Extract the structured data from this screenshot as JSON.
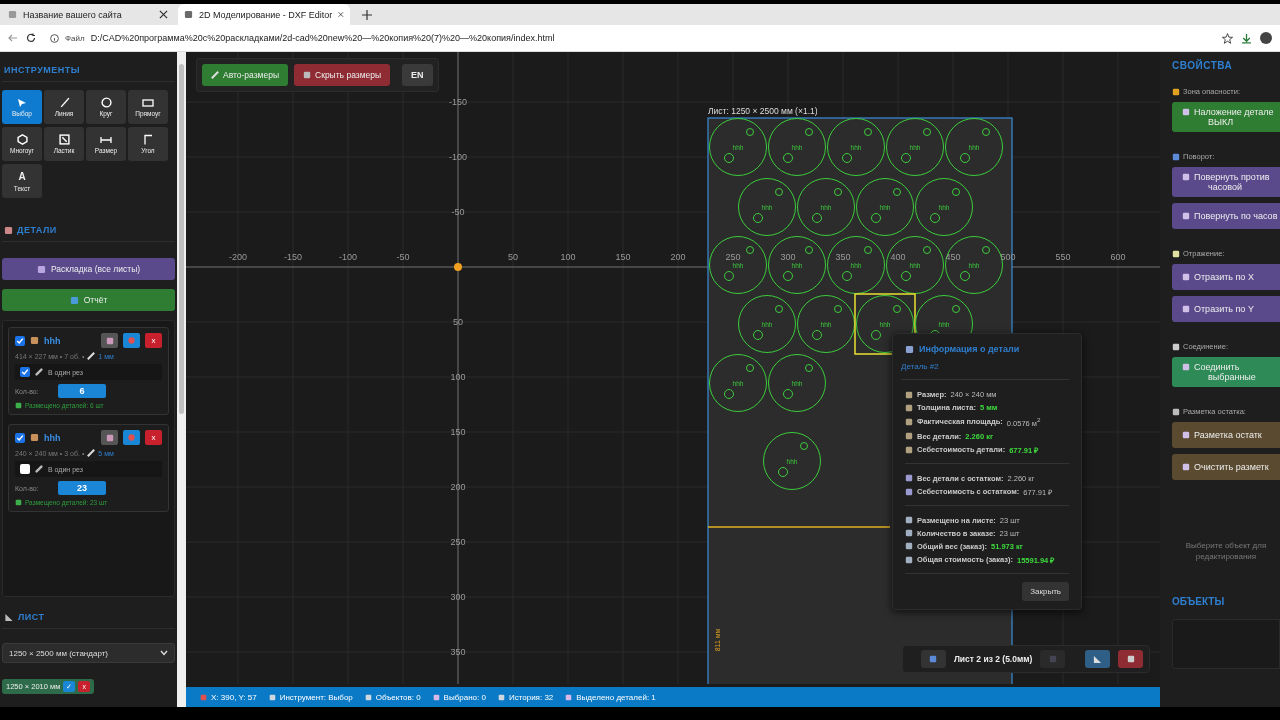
{
  "browser": {
    "tabs": [
      {
        "title": "Название вашего сайта",
        "selected": false
      },
      {
        "title": "2D Моделирование - DXF Editor",
        "selected": true
      }
    ],
    "address": {
      "scheme": "Файл",
      "url": "D:/CAD%20программа%20c%20раскладками/2d-cad%20new%20—%20копия%20(7)%20—%20копия/index.html"
    }
  },
  "toolbar": {
    "buttons": [
      {
        "label": "Авто-размеры",
        "kind": "green"
      },
      {
        "label": "Скрыть размеры",
        "kind": "red"
      },
      {
        "label": "EN",
        "kind": "plain"
      }
    ]
  },
  "tools": {
    "title": "ИНСТРУМЕНТЫ",
    "items": [
      {
        "label": "Выбор",
        "selected": true
      },
      {
        "label": "Линия",
        "selected": false
      },
      {
        "label": "Круг",
        "selected": false
      },
      {
        "label": "Прямоуг",
        "selected": false
      },
      {
        "label": "Многоуг",
        "selected": false
      },
      {
        "label": "Ластик",
        "selected": false
      },
      {
        "label": "Размер",
        "selected": false
      },
      {
        "label": "Угол",
        "selected": false
      },
      {
        "label": "Текст",
        "glyph": "A",
        "selected": false
      }
    ]
  },
  "details": {
    "title": "ДЕТАЛИ",
    "buttons": [
      {
        "label": "Раскладка (все листы)",
        "kind": "purple"
      },
      {
        "label": "Отчёт",
        "kind": "green"
      }
    ],
    "parts": [
      {
        "checked": true,
        "name": "hhh",
        "dims": "414 × 227 мм • 7 об. •",
        "thickness": "1 мм",
        "one_cut": {
          "checked": true,
          "label": "В один рез"
        },
        "qty_label": "Кол-во:",
        "qty": "6",
        "placed": "Размещено деталей: 6 шт",
        "delete": "x"
      },
      {
        "checked": true,
        "name": "hhh",
        "dims": "240 × 240 мм • 3 об. •",
        "thickness": "5 мм",
        "one_cut": {
          "checked": false,
          "label": "В один рез"
        },
        "qty_label": "Кол-во:",
        "qty": "23",
        "placed": "Размещено деталей: 23 шт",
        "delete": "x"
      }
    ]
  },
  "sheet": {
    "title": "ЛИСТ",
    "select": "1250 × 2500 мм (стандарт)",
    "custom": "1250 × 2010 мм",
    "custom_ok": "✓",
    "custom_remove": "x"
  },
  "canvas": {
    "sheet_label": "Лист: 1250 × 2500 мм (×1.1)",
    "x_ticks": [
      "-200",
      "-150",
      "-100",
      "-50",
      "50",
      "100",
      "150",
      "200",
      "250",
      "300",
      "350",
      "400",
      "450",
      "500",
      "550",
      "600"
    ],
    "y_ticks": [
      "-150",
      "-100",
      "-50",
      "50",
      "100",
      "150",
      "200",
      "250",
      "300",
      "350"
    ],
    "remnant_label": "811 мм",
    "parts": [
      {
        "label": "hhh",
        "selected": false
      },
      {
        "label": "hhh",
        "selected": false
      },
      {
        "label": "hhh",
        "selected": false
      },
      {
        "label": "hhh",
        "selected": false
      },
      {
        "label": "hhh",
        "selected": false
      },
      {
        "label": "hhh",
        "selected": false
      },
      {
        "label": "hhh",
        "selected": false
      },
      {
        "label": "hhh",
        "selected": false
      },
      {
        "label": "hhh",
        "selected": false
      },
      {
        "label": "hhh",
        "selected": false
      },
      {
        "label": "hhh",
        "selected": false
      },
      {
        "label": "hhh",
        "selected": false
      },
      {
        "label": "hhh",
        "selected": false
      },
      {
        "label": "hhh",
        "selected": false
      },
      {
        "label": "hhh",
        "selected": false
      },
      {
        "label": "hhh",
        "selected": false
      },
      {
        "label": "hhh",
        "selected": true
      },
      {
        "label": "hhh",
        "selected": false
      },
      {
        "label": "hhh",
        "selected": false
      },
      {
        "label": "hhh",
        "selected": false
      },
      {
        "label": "hhh",
        "selected": false
      }
    ]
  },
  "info": {
    "title": "Информация о детали",
    "subtitle": "Деталь #2",
    "groups": [
      [
        {
          "label": "Размер:",
          "value": "240 × 240 мм",
          "highlight": false
        },
        {
          "label": "Толщина листа:",
          "value": "5 мм",
          "highlight": true
        },
        {
          "label": "Фактическая площадь:",
          "value": "0.0576 м$^{2}$",
          "highlight": false
        },
        {
          "label": "Вес детали:",
          "value": "2.260 кг",
          "highlight": true
        },
        {
          "label": "Себестоимость детали:",
          "value": "677.91 ₽",
          "highlight": true
        }
      ],
      [
        {
          "label": "Вес детали с остатком:",
          "value": "2.260 кг",
          "highlight": false
        },
        {
          "label": "Себестоимость с остатком:",
          "value": "677.91 ₽",
          "highlight": false
        }
      ],
      [
        {
          "label": "Размещено на листе:",
          "value": "23 шт",
          "highlight": false
        },
        {
          "label": "Количество в заказе:",
          "value": "23 шт",
          "highlight": false
        },
        {
          "label": "Общий вес (заказ):",
          "value": "51.973 кг",
          "highlight": true
        },
        {
          "label": "Общая стоимость (заказ):",
          "value": "15591.94 ₽",
          "highlight": true
        }
      ]
    ],
    "close": "Закрыть"
  },
  "sheet_nav": {
    "label": "Лист 2 из 2 (5.0мм)"
  },
  "properties": {
    "title": "СВОЙСТВА",
    "sections": [
      {
        "label": "Зона опасности:",
        "buttons": [
          {
            "label": "Наложение детале",
            "sub": "ВЫКЛ",
            "kind": "green"
          }
        ]
      },
      {
        "label": "Поворот:",
        "buttons": [
          {
            "label": "Повернуть против",
            "sub": "часовой",
            "kind": "purple"
          },
          {
            "label": "Повернуть по часов",
            "kind": "purple"
          }
        ]
      },
      {
        "label": "Отражение:",
        "buttons": [
          {
            "label": "Отразить по X",
            "kind": "purple"
          },
          {
            "label": "Отразить по Y",
            "kind": "purple"
          }
        ]
      },
      {
        "label": "Соединение:",
        "buttons": [
          {
            "label": "Соединить",
            "sub": "выбранные",
            "kind": "teal"
          }
        ]
      },
      {
        "label": "Разметка остатка:",
        "buttons": [
          {
            "label": "Разметка остатк",
            "kind": "brown"
          },
          {
            "label": "Очистить разметк",
            "kind": "brown"
          }
        ]
      }
    ],
    "hint": "Выберите объект для редактирования",
    "objects_title": "ОБЪЕКТЫ"
  },
  "status": [
    {
      "text": "X: 390, Y: 57"
    },
    {
      "text": "Инструмент: Выбор"
    },
    {
      "text": "Объектов: 0"
    },
    {
      "text": "Выбрано: 0"
    },
    {
      "text": "История: 32"
    },
    {
      "text": "Выделено деталей: 1"
    }
  ]
}
